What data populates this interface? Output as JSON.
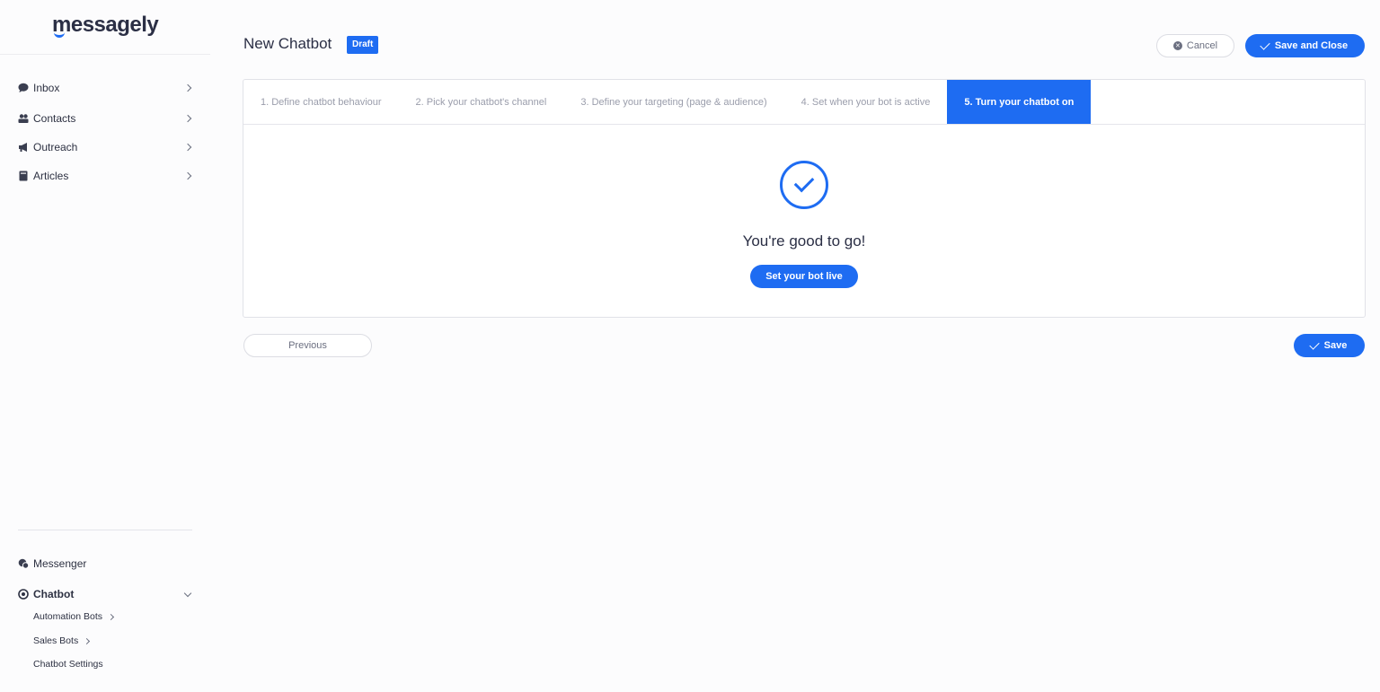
{
  "app": {
    "logo_text": "messagely"
  },
  "sidebar": {
    "nav": [
      {
        "label": "Inbox",
        "icon": "chat-bubble-icon"
      },
      {
        "label": "Contacts",
        "icon": "contacts-icon"
      },
      {
        "label": "Outreach",
        "icon": "megaphone-icon"
      },
      {
        "label": "Articles",
        "icon": "book-icon"
      }
    ],
    "messenger": {
      "label": "Messenger",
      "icon": "messenger-icon"
    },
    "chatbot": {
      "label": "Chatbot",
      "icon": "chatbot-icon",
      "children": [
        {
          "label": "Automation Bots"
        },
        {
          "label": "Sales Bots"
        },
        {
          "label": "Chatbot Settings"
        }
      ]
    }
  },
  "header": {
    "title": "New Chatbot",
    "status_badge": "Draft",
    "cancel_label": "Cancel",
    "save_close_label": "Save and Close"
  },
  "wizard": {
    "steps": [
      "1. Define chatbot behaviour",
      "2. Pick your chatbot's channel",
      "3. Define your targeting (page & audience)",
      "4. Set when your bot is active",
      "5. Turn your chatbot on"
    ],
    "active_step": 5,
    "message": "You're good to go!",
    "cta_label": "Set your bot live"
  },
  "footer": {
    "previous_label": "Previous",
    "save_label": "Save"
  },
  "colors": {
    "accent": "#1e6cf2",
    "text": "#2d3142",
    "muted": "#9a9dab"
  }
}
